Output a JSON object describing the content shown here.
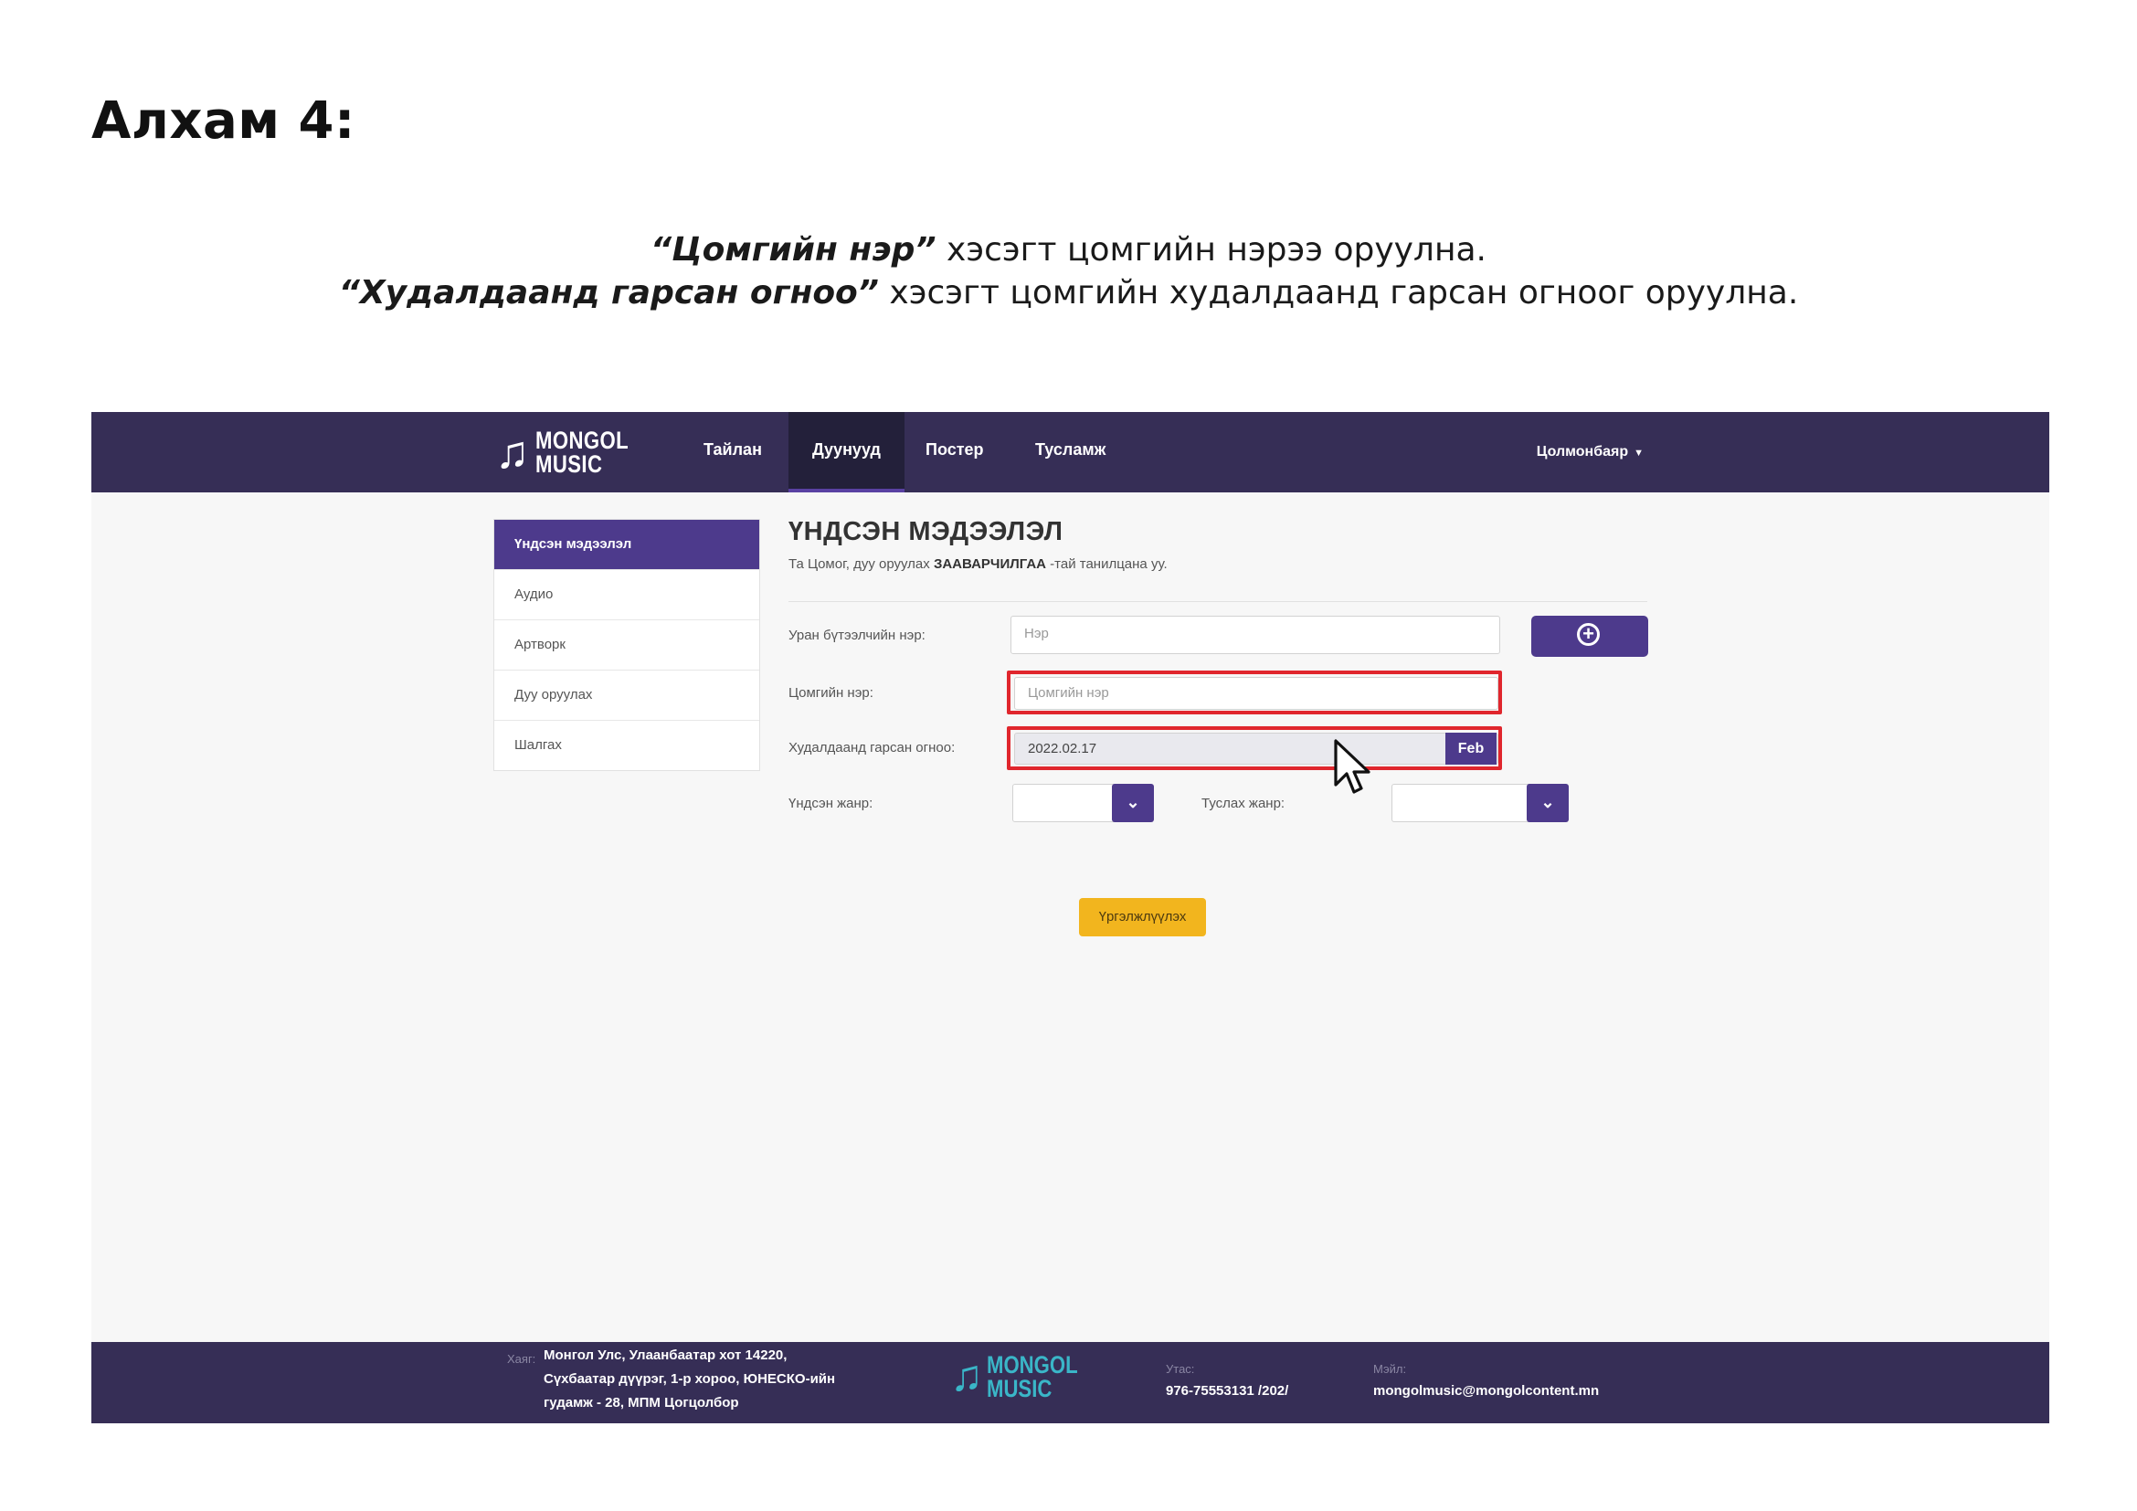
{
  "slide": {
    "step_title": "Алхам 4:",
    "instruction_1_em": "“Цомгийн нэр”",
    "instruction_1_rest": " хэсэгт цомгийн нэрээ оруулна.",
    "instruction_2_em": "“Худалдаанд гарсан огноо”",
    "instruction_2_rest": " хэсэгт цомгийн худалдаанд гарсан огноог оруулна."
  },
  "header": {
    "logo_line1": "MONGOL",
    "logo_line2": "MUSIC",
    "nav": [
      "Тайлан",
      "Дуунууд",
      "Постер",
      "Тусламж"
    ],
    "active_nav": "Дуунууд",
    "user": "Цолмонбаяр"
  },
  "sidebar": {
    "items": [
      "Үндсэн мэдээлэл",
      "Аудио",
      "Артворк",
      "Дуу оруулах",
      "Шалгах"
    ],
    "active": "Үндсэн мэдээлэл"
  },
  "main": {
    "title": "ҮНДСЭН МЭДЭЭЛЭЛ",
    "subtitle_pre": "Та Цомог, дуу оруулах ",
    "subtitle_bold": "ЗААВАРЧИЛГАА",
    "subtitle_post": " -тай танилцана уу.",
    "artist_label": "Уран бүтээлчийн нэр:",
    "artist_placeholder": "Нэр",
    "album_label": "Цомгийн нэр:",
    "album_placeholder": "Цомгийн нэр",
    "release_label": "Худалдаанд гарсан огноо:",
    "release_value": "2022.02.17",
    "release_month": "Feb",
    "main_genre_label": "Үндсэн жанр:",
    "sub_genre_label": "Туслах жанр:",
    "continue_label": "Үргэлжлүүлэх"
  },
  "footer": {
    "address_label": "Хаяг:",
    "address_lines": [
      "Монгол Улс, Улаанбаатар хот 14220,",
      "Сүхбаатар дүүрэг, 1-р хороо, ЮНЕСКО-ийн",
      "гудамж - 28, МПМ Цогцолбор"
    ],
    "phone_label": "Утас:",
    "phone": "976-75553131 /202/",
    "email_label": "Мэйл:",
    "email": "mongolmusic@mongolcontent.mn"
  },
  "colors": {
    "navbar": "#362e56",
    "accent": "#4d3a8c",
    "highlight": "#e0262d",
    "continue": "#f2b51e",
    "footer_logo": "#3ab6c8"
  }
}
